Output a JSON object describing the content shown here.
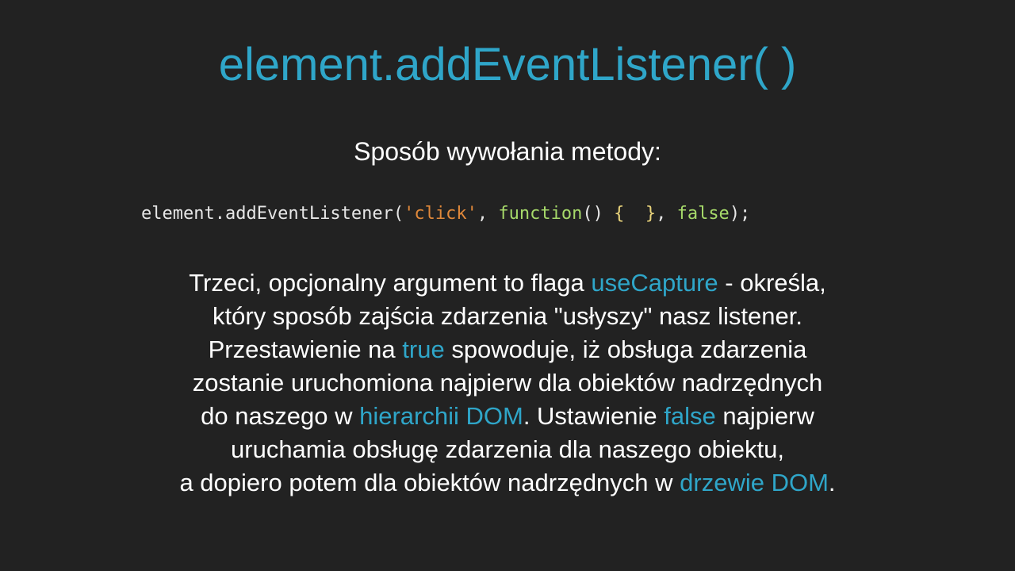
{
  "slide": {
    "title": "element.addEventListener( )",
    "subtitle": "Sposób wywołania metody:",
    "code": {
      "method": "element.addEventListener(",
      "event_string": "'click'",
      "comma1": ", ",
      "function_keyword": "function",
      "parens": "() ",
      "brace_open": "{",
      "body_space": "  ",
      "brace_close": "}",
      "comma2": ", ",
      "false_keyword": "false",
      "closing": ");"
    },
    "paragraph": {
      "line1": {
        "a": "Trzeci, opcjonalny argument to flaga ",
        "b": "useCapture",
        "c": " - określa,"
      },
      "line2": {
        "a": "który sposób zajścia zdarzenia \"usłyszy\" nasz listener."
      },
      "line3": {
        "a": "Przestawienie na ",
        "b": "true",
        "c": " spowoduje, iż obsługa zdarzenia"
      },
      "line4": {
        "a": "zostanie uruchomiona najpierw dla obiektów nadrzędnych"
      },
      "line5": {
        "a": "do naszego w ",
        "b": "hierarchii DOM",
        "c": ". Ustawienie ",
        "d": "false",
        "e": " najpierw"
      },
      "line6": {
        "a": "uruchamia obsługę zdarzenia dla naszego obiektu,"
      },
      "line7": {
        "a": "a dopiero potem dla obiektów nadrzędnych w ",
        "b": "drzewie DOM",
        "c": "."
      }
    },
    "colors": {
      "background": "#222222",
      "accent": "#2fa6c9",
      "text": "#ffffff",
      "code_string": "#e0883a",
      "code_keyword": "#a6d96a",
      "code_brace": "#e8d27a"
    }
  }
}
